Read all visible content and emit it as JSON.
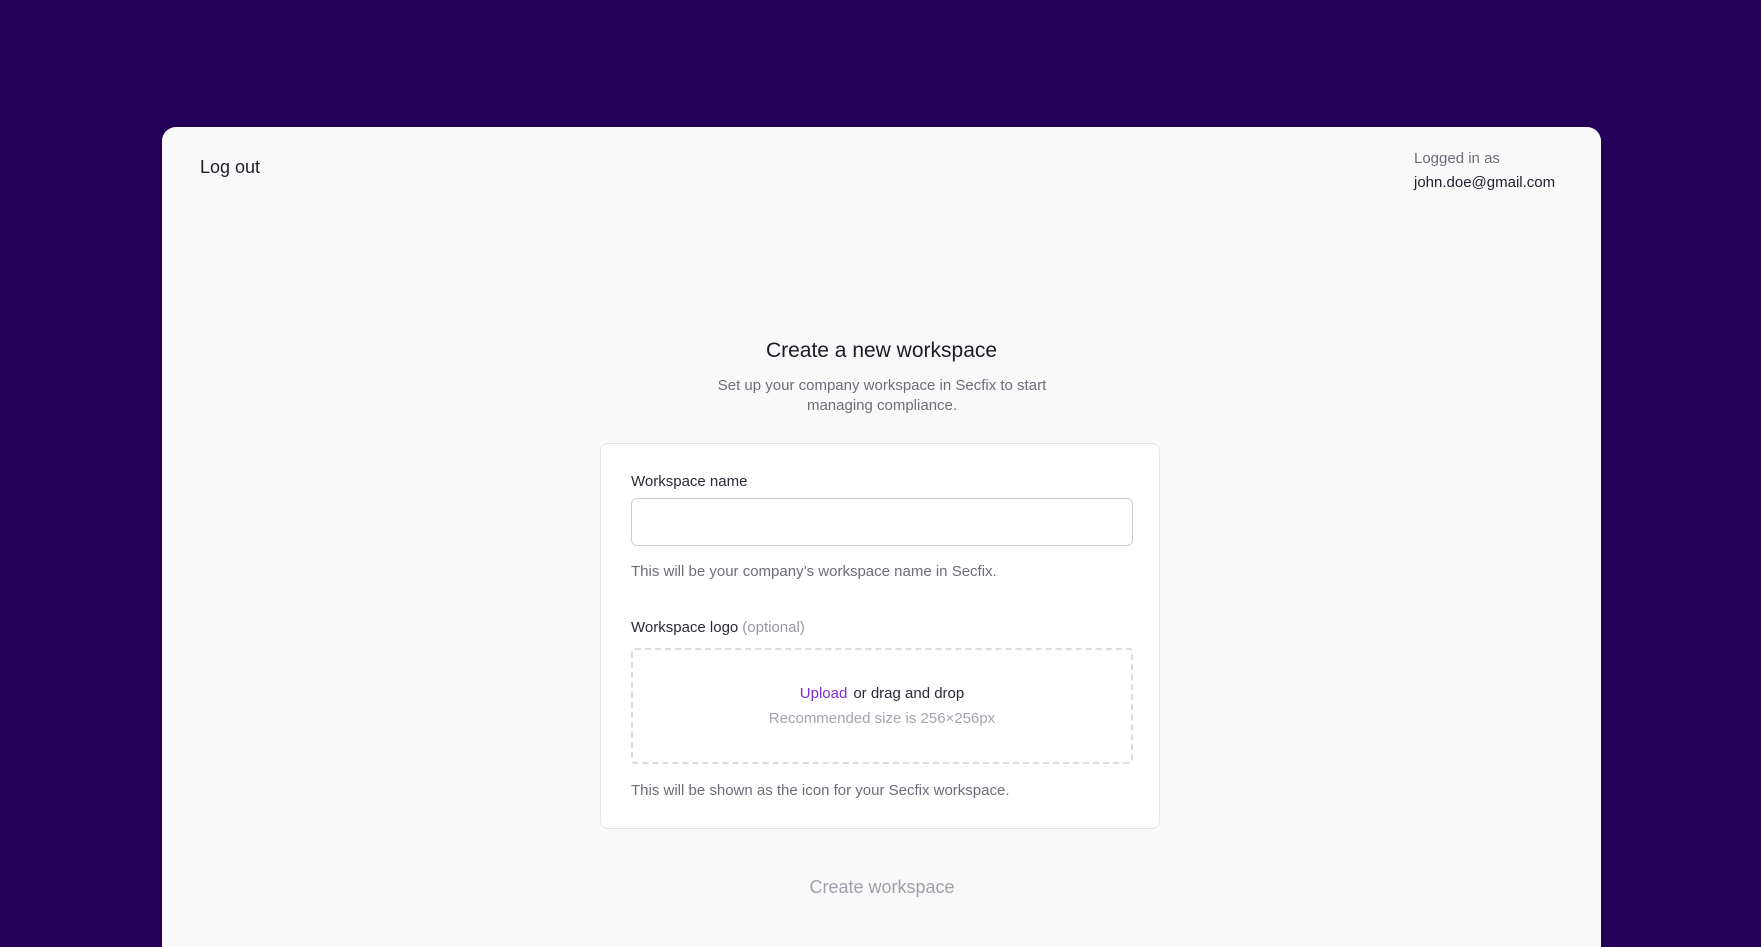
{
  "header": {
    "logout_label": "Log out",
    "logged_in_label": "Logged in as",
    "user_email": "john.doe@gmail.com"
  },
  "main": {
    "title": "Create a new workspace",
    "subtitle": "Set up your company workspace in Secfix to start managing compliance."
  },
  "form": {
    "name_label": "Workspace name",
    "name_value": "",
    "name_placeholder": "",
    "name_hint": "This will be your company’s workspace name in Secfix.",
    "logo_label": "Workspace logo",
    "logo_optional": "(optional)",
    "upload_link": "Upload",
    "drag_text": "or drag and drop",
    "recommended_size": "Recommended size is 256×256px",
    "logo_hint": "This will be shown as the icon for your Secfix workspace."
  },
  "actions": {
    "create_label": "Create workspace"
  },
  "colors": {
    "background": "#250059",
    "accent": "#7a2ed6"
  }
}
